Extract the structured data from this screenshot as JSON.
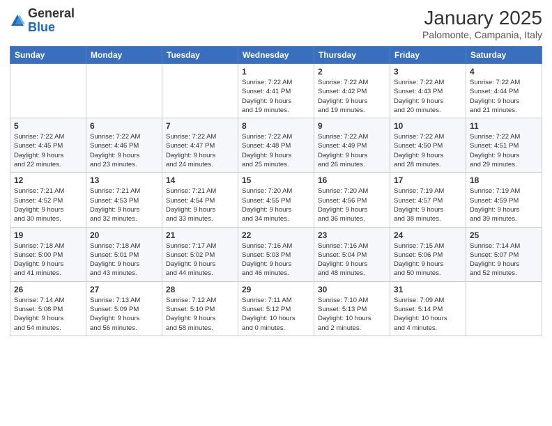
{
  "logo": {
    "general": "General",
    "blue": "Blue"
  },
  "header": {
    "month": "January 2025",
    "location": "Palomonte, Campania, Italy"
  },
  "weekdays": [
    "Sunday",
    "Monday",
    "Tuesday",
    "Wednesday",
    "Thursday",
    "Friday",
    "Saturday"
  ],
  "weeks": [
    [
      {
        "day": "",
        "info": ""
      },
      {
        "day": "",
        "info": ""
      },
      {
        "day": "",
        "info": ""
      },
      {
        "day": "1",
        "info": "Sunrise: 7:22 AM\nSunset: 4:41 PM\nDaylight: 9 hours\nand 19 minutes."
      },
      {
        "day": "2",
        "info": "Sunrise: 7:22 AM\nSunset: 4:42 PM\nDaylight: 9 hours\nand 19 minutes."
      },
      {
        "day": "3",
        "info": "Sunrise: 7:22 AM\nSunset: 4:43 PM\nDaylight: 9 hours\nand 20 minutes."
      },
      {
        "day": "4",
        "info": "Sunrise: 7:22 AM\nSunset: 4:44 PM\nDaylight: 9 hours\nand 21 minutes."
      }
    ],
    [
      {
        "day": "5",
        "info": "Sunrise: 7:22 AM\nSunset: 4:45 PM\nDaylight: 9 hours\nand 22 minutes."
      },
      {
        "day": "6",
        "info": "Sunrise: 7:22 AM\nSunset: 4:46 PM\nDaylight: 9 hours\nand 23 minutes."
      },
      {
        "day": "7",
        "info": "Sunrise: 7:22 AM\nSunset: 4:47 PM\nDaylight: 9 hours\nand 24 minutes."
      },
      {
        "day": "8",
        "info": "Sunrise: 7:22 AM\nSunset: 4:48 PM\nDaylight: 9 hours\nand 25 minutes."
      },
      {
        "day": "9",
        "info": "Sunrise: 7:22 AM\nSunset: 4:49 PM\nDaylight: 9 hours\nand 26 minutes."
      },
      {
        "day": "10",
        "info": "Sunrise: 7:22 AM\nSunset: 4:50 PM\nDaylight: 9 hours\nand 28 minutes."
      },
      {
        "day": "11",
        "info": "Sunrise: 7:22 AM\nSunset: 4:51 PM\nDaylight: 9 hours\nand 29 minutes."
      }
    ],
    [
      {
        "day": "12",
        "info": "Sunrise: 7:21 AM\nSunset: 4:52 PM\nDaylight: 9 hours\nand 30 minutes."
      },
      {
        "day": "13",
        "info": "Sunrise: 7:21 AM\nSunset: 4:53 PM\nDaylight: 9 hours\nand 32 minutes."
      },
      {
        "day": "14",
        "info": "Sunrise: 7:21 AM\nSunset: 4:54 PM\nDaylight: 9 hours\nand 33 minutes."
      },
      {
        "day": "15",
        "info": "Sunrise: 7:20 AM\nSunset: 4:55 PM\nDaylight: 9 hours\nand 34 minutes."
      },
      {
        "day": "16",
        "info": "Sunrise: 7:20 AM\nSunset: 4:56 PM\nDaylight: 9 hours\nand 36 minutes."
      },
      {
        "day": "17",
        "info": "Sunrise: 7:19 AM\nSunset: 4:57 PM\nDaylight: 9 hours\nand 38 minutes."
      },
      {
        "day": "18",
        "info": "Sunrise: 7:19 AM\nSunset: 4:59 PM\nDaylight: 9 hours\nand 39 minutes."
      }
    ],
    [
      {
        "day": "19",
        "info": "Sunrise: 7:18 AM\nSunset: 5:00 PM\nDaylight: 9 hours\nand 41 minutes."
      },
      {
        "day": "20",
        "info": "Sunrise: 7:18 AM\nSunset: 5:01 PM\nDaylight: 9 hours\nand 43 minutes."
      },
      {
        "day": "21",
        "info": "Sunrise: 7:17 AM\nSunset: 5:02 PM\nDaylight: 9 hours\nand 44 minutes."
      },
      {
        "day": "22",
        "info": "Sunrise: 7:16 AM\nSunset: 5:03 PM\nDaylight: 9 hours\nand 46 minutes."
      },
      {
        "day": "23",
        "info": "Sunrise: 7:16 AM\nSunset: 5:04 PM\nDaylight: 9 hours\nand 48 minutes."
      },
      {
        "day": "24",
        "info": "Sunrise: 7:15 AM\nSunset: 5:06 PM\nDaylight: 9 hours\nand 50 minutes."
      },
      {
        "day": "25",
        "info": "Sunrise: 7:14 AM\nSunset: 5:07 PM\nDaylight: 9 hours\nand 52 minutes."
      }
    ],
    [
      {
        "day": "26",
        "info": "Sunrise: 7:14 AM\nSunset: 5:08 PM\nDaylight: 9 hours\nand 54 minutes."
      },
      {
        "day": "27",
        "info": "Sunrise: 7:13 AM\nSunset: 5:09 PM\nDaylight: 9 hours\nand 56 minutes."
      },
      {
        "day": "28",
        "info": "Sunrise: 7:12 AM\nSunset: 5:10 PM\nDaylight: 9 hours\nand 58 minutes."
      },
      {
        "day": "29",
        "info": "Sunrise: 7:11 AM\nSunset: 5:12 PM\nDaylight: 10 hours\nand 0 minutes."
      },
      {
        "day": "30",
        "info": "Sunrise: 7:10 AM\nSunset: 5:13 PM\nDaylight: 10 hours\nand 2 minutes."
      },
      {
        "day": "31",
        "info": "Sunrise: 7:09 AM\nSunset: 5:14 PM\nDaylight: 10 hours\nand 4 minutes."
      },
      {
        "day": "",
        "info": ""
      }
    ]
  ]
}
